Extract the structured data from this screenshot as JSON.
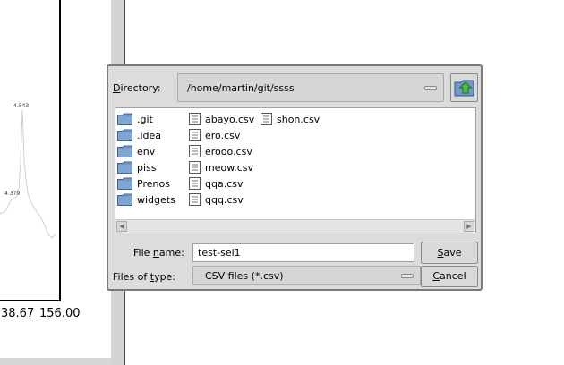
{
  "background_plot": {
    "peak_labels": [
      "4.543",
      "4.379"
    ],
    "x_tick_labels": [
      "38.67",
      "156.00"
    ]
  },
  "dialog": {
    "directory_label": "Directory:",
    "directory_value": "/home/martin/git/ssss",
    "up_button_icon": "folder-up-icon",
    "folders": [
      ".git",
      ".idea",
      "env",
      "piss",
      "Prenos",
      "widgets"
    ],
    "files_col1": [
      "abayo.csv",
      "ero.csv",
      "erooo.csv",
      "meow.csv",
      "qqa.csv",
      "qqq.csv"
    ],
    "files_col2": [
      "shon.csv"
    ],
    "file_name_label": "File name:",
    "file_name_value": "test-sel1",
    "file_type_label": "Files of type:",
    "file_type_value": "CSV files (*.csv)",
    "save_label": "Save",
    "cancel_label": "Cancel"
  }
}
